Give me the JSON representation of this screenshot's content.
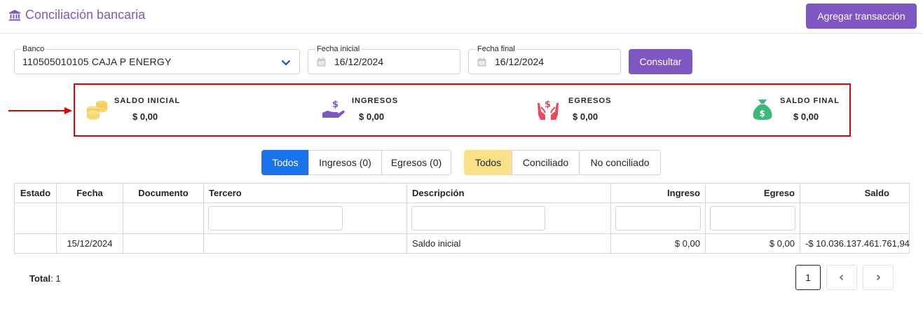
{
  "header": {
    "title": "Conciliación bancaria",
    "title_icon": "bank-icon",
    "add_button_label": "Agregar transacción",
    "accent_color": "#7e57c2"
  },
  "filters": {
    "bank_label": "Banco",
    "bank_value": "110505010105 CAJA P ENERGY",
    "start_date_label": "Fecha inicial",
    "start_date_value": "16/12/2024",
    "end_date_label": "Fecha final",
    "end_date_value": "16/12/2024",
    "query_button_label": "Consultar"
  },
  "summary": {
    "items": [
      {
        "label": "SALDO INICIAL",
        "value": "$ 0,00",
        "icon": "coins-icon",
        "color": "#f7d774"
      },
      {
        "label": "INGRESOS",
        "value": "$ 0,00",
        "icon": "hand-money-icon",
        "color": "#7e57c2"
      },
      {
        "label": "EGRESOS",
        "value": "$ 0,00",
        "icon": "hands-money-icon",
        "color": "#e84a5f"
      },
      {
        "label": "SALDO FINAL",
        "value": "$ 0,00",
        "icon": "money-bag-icon",
        "color": "#3cb878"
      }
    ],
    "highlight_color": "#e00000"
  },
  "type_filter": {
    "buttons": [
      "Todos",
      "Ingresos (0)",
      "Egresos (0)"
    ],
    "active": "Todos"
  },
  "status_filter": {
    "buttons": [
      "Todos",
      "Conciliado",
      "No conciliado"
    ],
    "active": "Todos"
  },
  "table": {
    "columns": [
      "Estado",
      "Fecha",
      "Documento",
      "Tercero",
      "Descripción",
      "Ingreso",
      "Egreso",
      "Saldo"
    ],
    "rows": [
      {
        "estado": "",
        "fecha": "15/12/2024",
        "documento": "",
        "tercero": "",
        "descripcion": "Saldo inicial",
        "ingreso": "$ 0,00",
        "egreso": "$ 0,00",
        "saldo": "-$ 10.036.137.461.761,94"
      }
    ]
  },
  "footer": {
    "total_label": "Total",
    "total_value": ": 1",
    "current_page": "1"
  }
}
